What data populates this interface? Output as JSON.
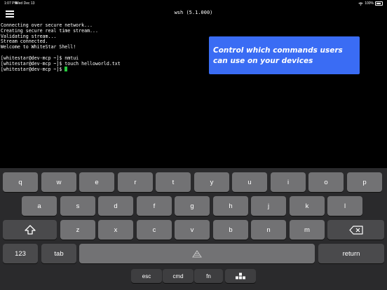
{
  "status_bar": {
    "time": "1:07 PM",
    "date": "Wed Dec 13",
    "battery": "100%"
  },
  "window": {
    "title": "wsh (5.1.000)"
  },
  "terminal": {
    "lines": [
      "Connecting over secure network...",
      "Creating secure real time stream...",
      "Validating stream...",
      "Stream connected.",
      "Welcome to WhiteStar Shell!",
      "",
      "[whitestar@dev-mcp ~]$ nmtui",
      "[whitestar@dev-mcp ~]$ touch helloworld.txt",
      "[whitestar@dev-mcp ~]$ "
    ]
  },
  "promo": {
    "text": "Control which commands users can use on your devices"
  },
  "keyboard": {
    "row1": [
      "q",
      "w",
      "e",
      "r",
      "t",
      "y",
      "u",
      "i",
      "o",
      "p"
    ],
    "row2": [
      "a",
      "s",
      "d",
      "f",
      "g",
      "h",
      "j",
      "k",
      "l"
    ],
    "row3": [
      "z",
      "x",
      "c",
      "v",
      "b",
      "n",
      "m"
    ],
    "row4": {
      "numbers": "123",
      "tab": "tab",
      "return": "return"
    },
    "row5": [
      "esc",
      "cmd",
      "fn"
    ]
  },
  "icons": {
    "menu": "hamburger-icon",
    "shift": "shift-icon",
    "backspace": "backspace-icon",
    "space_logo": "triangle-logo-icon",
    "keyboard_toggle": "grid-icon",
    "wifi": "wifi-icon",
    "battery": "battery-icon"
  }
}
